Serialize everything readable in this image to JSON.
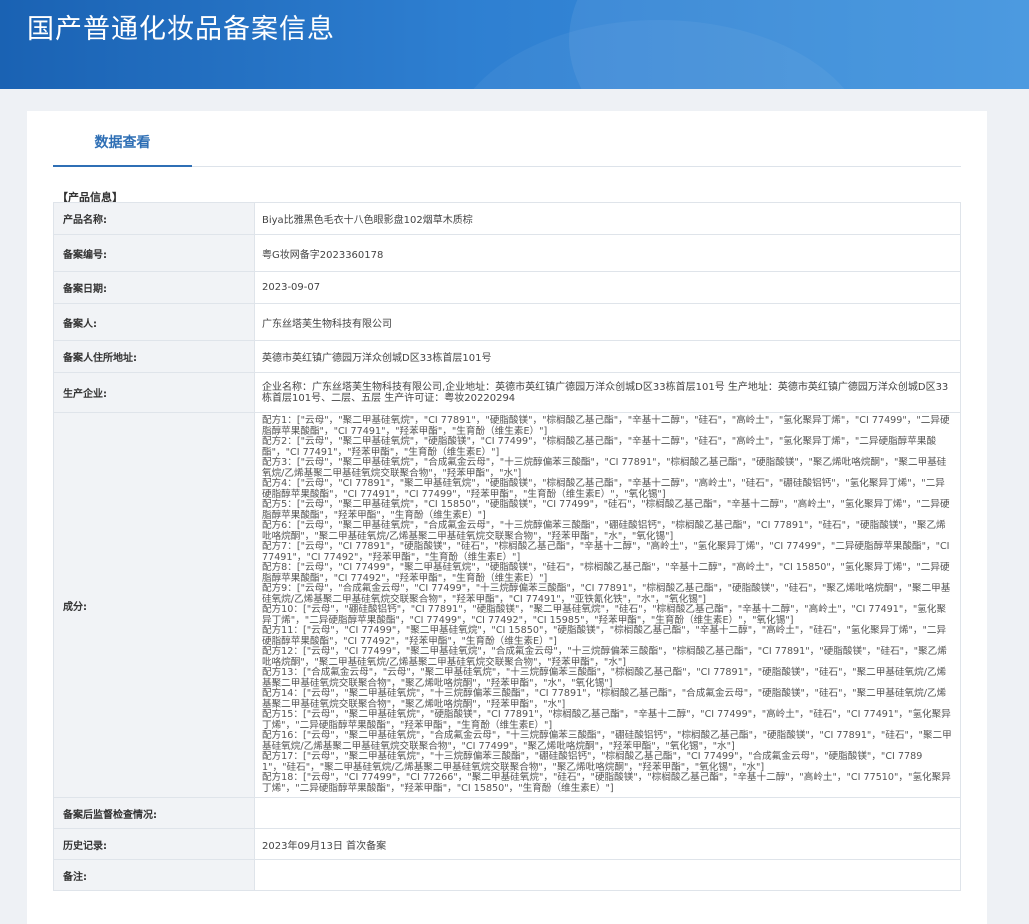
{
  "header": {
    "title": "国产普通化妆品备案信息"
  },
  "tabs": [
    {
      "label": "数据查看"
    }
  ],
  "section": {
    "title": "【产品信息】"
  },
  "rows": {
    "product_name": {
      "label": "产品名称:",
      "value": "Biya比雅黑色毛衣十八色眼影盘102烟草木质棕"
    },
    "record_no": {
      "label": "备案编号:",
      "value": "粤G妆网备字2023360178"
    },
    "record_date": {
      "label": "备案日期:",
      "value": "2023-09-07"
    },
    "registrant": {
      "label": "备案人:",
      "value": "广东丝塔芙生物科技有限公司"
    },
    "registrant_address": {
      "label": "备案人住所地址:",
      "value": "英德市英红镇广德园万洋众创城D区33栋首层101号"
    },
    "manufacturer": {
      "label": "生产企业:",
      "value": "企业名称：广东丝塔芙生物科技有限公司,企业地址：英德市英红镇广德园万洋众创城D区33栋首层101号 生产地址：英德市英红镇广德园万洋众创城D区33栋首层101号、二层、五层 生产许可证：粤妆20220294"
    },
    "ingredients_label": "成分:",
    "post_supervision": {
      "label": "备案后监督检查情况:",
      "value": ""
    },
    "history": {
      "label": "历史记录:",
      "value": "2023年09月13日 首次备案"
    },
    "remarks": {
      "label": "备注:",
      "value": ""
    }
  },
  "ingredients": [
    "配方1：[\"云母\"，\"聚二甲基硅氧烷\"，\"CI 77891\"，\"硬脂酸镁\"，\"棕榈酸乙基己酯\"，\"辛基十二醇\"，\"硅石\"，\"高岭土\"，\"氢化聚异丁烯\"，\"CI 77499\"，\"二异硬脂醇苹果酸酯\"，\"CI 77491\"，\"羟苯甲酯\"，\"生育酚（维生素E）\"]",
    "配方2：[\"云母\"，\"聚二甲基硅氧烷\"，\"硬脂酸镁\"，\"CI 77499\"，\"棕榈酸乙基己酯\"，\"辛基十二醇\"，\"硅石\"，\"高岭土\"，\"氢化聚异丁烯\"，\"二异硬脂醇苹果酸酯\"，\"CI 77491\"，\"羟苯甲酯\"，\"生育酚（维生素E）\"]",
    "配方3：[\"云母\"，\"聚二甲基硅氧烷\"，\"合成氟金云母\"，\"十三烷醇偏苯三酸酯\"，\"CI 77891\"，\"棕榈酸乙基己酯\"，\"硬脂酸镁\"，\"聚乙烯吡咯烷酮\"，\"聚二甲基硅氧烷/乙烯基聚二甲基硅氧烷交联聚合物\"，\"羟苯甲酯\"，\"水\"]",
    "配方4：[\"云母\"，\"CI 77891\"，\"聚二甲基硅氧烷\"，\"硬脂酸镁\"，\"棕榈酸乙基己酯\"，\"辛基十二醇\"，\"高岭土\"，\"硅石\"，\"硼硅酸铝钙\"，\"氢化聚异丁烯\"，\"二异硬脂醇苹果酸酯\"，\"CI 77491\"，\"CI 77499\"，\"羟苯甲酯\"，\"生育酚（维生素E）\"，\"氧化锡\"]",
    "配方5：[\"云母\"，\"聚二甲基硅氧烷\"，\"CI 15850\"，\"硬脂酸镁\"，\"CI 77499\"，\"硅石\"，\"棕榈酸乙基己酯\"，\"辛基十二醇\"，\"高岭土\"，\"氢化聚异丁烯\"，\"二异硬脂醇苹果酸酯\"，\"羟苯甲酯\"，\"生育酚（维生素E）\"]",
    "配方6：[\"云母\"，\"聚二甲基硅氧烷\"，\"合成氟金云母\"，\"十三烷醇偏苯三酸酯\"，\"硼硅酸铝钙\"，\"棕榈酸乙基己酯\"，\"CI 77891\"，\"硅石\"，\"硬脂酸镁\"，\"聚乙烯吡咯烷酮\"，\"聚二甲基硅氧烷/乙烯基聚二甲基硅氧烷交联聚合物\"，\"羟苯甲酯\"，\"水\"，\"氧化锡\"]",
    "配方7：[\"云母\"，\"CI 77891\"，\"硬脂酸镁\"，\"硅石\"，\"棕榈酸乙基己酯\"，\"辛基十二醇\"，\"高岭土\"，\"氢化聚异丁烯\"，\"CI 77499\"，\"二异硬脂醇苹果酸酯\"，\"CI 77491\"，\"CI 77492\"，\"羟苯甲酯\"，\"生育酚（维生素E）\"]",
    "配方8：[\"云母\"，\"CI 77499\"，\"聚二甲基硅氧烷\"，\"硬脂酸镁\"，\"硅石\"，\"棕榈酸乙基己酯\"，\"辛基十二醇\"，\"高岭土\"，\"CI 15850\"，\"氢化聚异丁烯\"，\"二异硬脂醇苹果酸酯\"，\"CI 77492\"，\"羟苯甲酯\"，\"生育酚（维生素E）\"]",
    "配方9：[\"云母\"，\"合成氟金云母\"，\"CI 77499\"，\"十三烷醇偏苯三酸酯\"，\"CI 77891\"，\"棕榈酸乙基己酯\"，\"硬脂酸镁\"，\"硅石\"，\"聚乙烯吡咯烷酮\"，\"聚二甲基硅氧烷/乙烯基聚二甲基硅氧烷交联聚合物\"，\"羟苯甲酯\"，\"CI 77491\"，\"亚铁氰化铁\"，\"水\"，\"氧化锡\"]",
    "配方10：[\"云母\"，\"硼硅酸铝钙\"，\"CI 77891\"，\"硬脂酸镁\"，\"聚二甲基硅氧烷\"，\"硅石\"，\"棕榈酸乙基己酯\"，\"辛基十二醇\"，\"高岭土\"，\"CI 77491\"，\"氢化聚异丁烯\"，\"二异硬脂醇苹果酸酯\"，\"CI 77499\"，\"CI 77492\"，\"CI 15985\"，\"羟苯甲酯\"，\"生育酚（维生素E）\"，\"氧化锡\"]",
    "配方11：[\"云母\"，\"CI 77499\"，\"聚二甲基硅氧烷\"，\"CI 15850\"，\"硬脂酸镁\"，\"棕榈酸乙基己酯\"，\"辛基十二醇\"，\"高岭土\"，\"硅石\"，\"氢化聚异丁烯\"，\"二异硬脂醇苹果酸酯\"，\"CI 77492\"，\"羟苯甲酯\"，\"生育酚（维生素E）\"]",
    "配方12：[\"云母\"，\"CI 77499\"，\"聚二甲基硅氧烷\"，\"合成氟金云母\"，\"十三烷醇偏苯三酸酯\"，\"棕榈酸乙基己酯\"，\"CI 77891\"，\"硬脂酸镁\"，\"硅石\"，\"聚乙烯吡咯烷酮\"，\"聚二甲基硅氧烷/乙烯基聚二甲基硅氧烷交联聚合物\"，\"羟苯甲酯\"，\"水\"]",
    "配方13：[\"合成氟金云母\"，\"云母\"，\"聚二甲基硅氧烷\"，\"十三烷醇偏苯三酸酯\"，\"棕榈酸乙基己酯\"，\"CI 77891\"，\"硬脂酸镁\"，\"硅石\"，\"聚二甲基硅氧烷/乙烯基聚二甲基硅氧烷交联聚合物\"，\"聚乙烯吡咯烷酮\"，\"羟苯甲酯\"，\"水\"，\"氧化锡\"]",
    "配方14：[\"云母\"，\"聚二甲基硅氧烷\"，\"十三烷醇偏苯三酸酯\"，\"CI 77891\"，\"棕榈酸乙基己酯\"，\"合成氟金云母\"，\"硬脂酸镁\"，\"硅石\"，\"聚二甲基硅氧烷/乙烯基聚二甲基硅氧烷交联聚合物\"，\"聚乙烯吡咯烷酮\"，\"羟苯甲酯\"，\"水\"]",
    "配方15：[\"云母\"，\"聚二甲基硅氧烷\"，\"硬脂酸镁\"，\"CI 77891\"，\"棕榈酸乙基己酯\"，\"辛基十二醇\"，\"CI 77499\"，\"高岭土\"，\"硅石\"，\"CI 77491\"，\"氢化聚异丁烯\"，\"二异硬脂醇苹果酸酯\"，\"羟苯甲酯\"，\"生育酚（维生素E）\"]",
    "配方16：[\"云母\"，\"聚二甲基硅氧烷\"，\"合成氟金云母\"，\"十三烷醇偏苯三酸酯\"，\"硼硅酸铝钙\"，\"棕榈酸乙基己酯\"，\"硬脂酸镁\"，\"CI 77891\"，\"硅石\"，\"聚二甲基硅氧烷/乙烯基聚二甲基硅氧烷交联聚合物\"，\"CI 77499\"，\"聚乙烯吡咯烷酮\"，\"羟苯甲酯\"，\"氧化锡\"，\"水\"]",
    "配方17：[\"云母\"，\"聚二甲基硅氧烷\"，\"十三烷醇偏苯三酸酯\"，\"硼硅酸铝钙\"，\"棕榈酸乙基己酯\"，\"CI 77499\"，\"合成氟金云母\"，\"硬脂酸镁\"，\"CI 77891\"，\"硅石\"，\"聚二甲基硅氧烷/乙烯基聚二甲基硅氧烷交联聚合物\"，\"聚乙烯吡咯烷酮\"，\"羟苯甲酯\"，\"氧化锡\"，\"水\"]",
    "配方18：[\"云母\"，\"CI 77499\"，\"CI 77266\"，\"聚二甲基硅氧烷\"，\"硅石\"，\"硬脂酸镁\"，\"棕榈酸乙基己酯\"，\"辛基十二醇\"，\"高岭土\"，\"CI 77510\"，\"氢化聚异丁烯\"，\"二异硬脂醇苹果酸酯\"，\"羟苯甲酯\"，\"CI 15850\"，\"生育酚（维生素E）\"]"
  ]
}
